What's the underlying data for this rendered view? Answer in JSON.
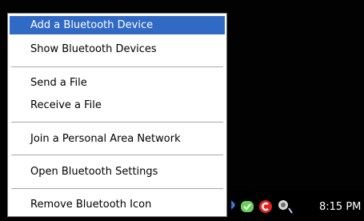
{
  "menu": {
    "items": [
      {
        "label": "Add a Bluetooth Device",
        "highlighted": true
      },
      {
        "label": "Show Bluetooth Devices"
      },
      {
        "label": "Send a File"
      },
      {
        "label": "Receive a File"
      },
      {
        "label": "Join a Personal Area Network"
      },
      {
        "label": "Open Bluetooth Settings"
      },
      {
        "label": "Remove Bluetooth Icon"
      }
    ]
  },
  "tray": {
    "icons": [
      "bluetooth-icon",
      "shield-check-icon",
      "antivirus-c-icon",
      "volume-icon"
    ],
    "clock": "8:15 PM"
  },
  "colors": {
    "highlight": "#316ac5",
    "desktop": "#000000"
  }
}
